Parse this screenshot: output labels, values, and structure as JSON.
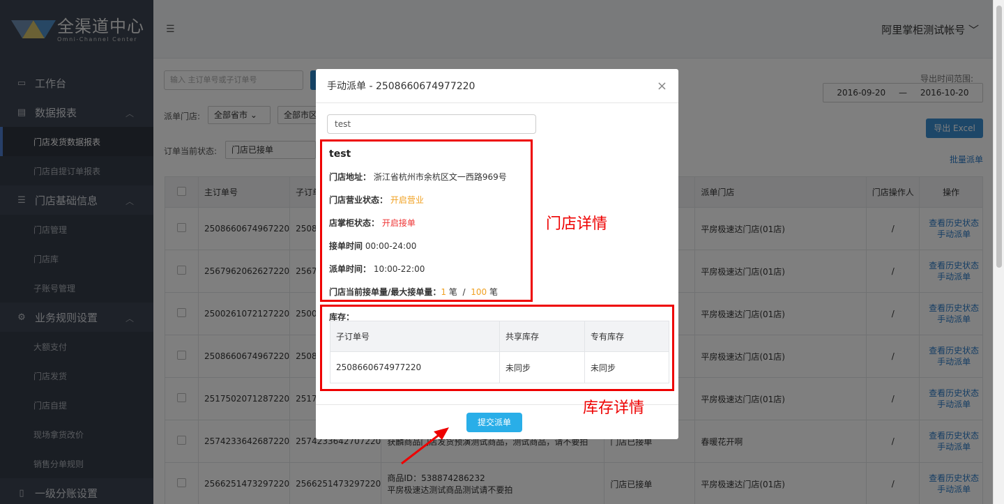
{
  "logo": {
    "title": "全渠道中心",
    "subtitle": "Omni-Channel Center"
  },
  "sidebar": {
    "groups": [
      {
        "label": "工作台",
        "icon": "monitor-icon"
      },
      {
        "label": "数据报表",
        "icon": "report-icon"
      },
      {
        "label": "门店基础信息",
        "icon": "list-icon"
      },
      {
        "label": "业务规则设置",
        "icon": "gear-icon"
      },
      {
        "label": "一级分账设置",
        "icon": "book-icon"
      }
    ],
    "report_items": [
      "门店发货数据报表",
      "门店自提订单报表"
    ],
    "store_items": [
      "门店管理",
      "门店库",
      "子账号管理"
    ],
    "rule_items": [
      "大额支付",
      "门店发货",
      "门店自提",
      "现场拿货改价",
      "销售分单规则"
    ]
  },
  "header": {
    "account": "阿里掌柜测试帐号",
    "menu_icon": "hamburger-icon"
  },
  "filters": {
    "search_placeholder": "输入 主订单号或子订单号",
    "export_range_label": "导出时间范围:",
    "date_from": "2016-09-20",
    "date_sep": "—",
    "date_to": "2016-10-20",
    "store_label": "派单门店:",
    "province": "全部省市",
    "district": "全部市区",
    "status_label": "订单当前状态:",
    "status": "门店已接单",
    "export_btn": "导出 Excel",
    "batch_link": "批量派单"
  },
  "table": {
    "headers": [
      "主订单号",
      "子订单号",
      "派单门店",
      "门店操作人",
      "操作"
    ],
    "op1": "查看历史状态",
    "op2": "手动派单",
    "rows": [
      {
        "main": "2508660674967220",
        "sub": "2508",
        "store": "平房极速达门店(01店)",
        "operator": "/"
      },
      {
        "main": "2567962062627220",
        "sub": "2567",
        "store": "平房极速达门店(01店)",
        "operator": "/"
      },
      {
        "main": "2500261072127220",
        "sub": "2500",
        "store": "平房极速达门店(01店)",
        "operator": "/"
      },
      {
        "main": "2508660674967220",
        "sub": "2508",
        "store": "平房极速达门店(01店)",
        "operator": "/"
      },
      {
        "main": "2517502071287220",
        "sub": "2517",
        "store": "平房极速达门店(01店)",
        "operator": "/"
      },
      {
        "main": "2574233642687220",
        "sub": "2574233642707220",
        "goods": "获麟商品门店发货预演测试商品，测试商品，请不要拍",
        "status": "门店已接单",
        "store": "春暖花开啊",
        "operator": "/"
      },
      {
        "main": "2566251473297220",
        "sub": "2566251473297220",
        "goods_id": "商品ID：538874286232",
        "goods": "平房极速达测试商品测试请不要拍",
        "status": "门店已接单",
        "store": "平房极速达门店(01店)",
        "operator": "/"
      }
    ]
  },
  "modal": {
    "title": "手动派单 - 2508660674977220",
    "close": "×",
    "input_value": "test",
    "store": {
      "name": "test",
      "address_label": "门店地址：",
      "address": "浙江省杭州市余杭区文一西路969号",
      "business_label": "门店营业状态：",
      "business_status": "开启营业",
      "counter_label": "店掌柜状态：",
      "counter_status": "开启接单",
      "accept_label": "接单时间",
      "accept_time": "00:00-24:00",
      "dispatch_label": "派单时间：",
      "dispatch_time": "10:00-22:00",
      "capacity_label": "门店当前接单量/最大接单量：",
      "current": "1",
      "unit1": "笔",
      "slash": "/",
      "max": "100",
      "unit2": "笔"
    },
    "stock": {
      "title": "库存：",
      "headers": [
        "子订单号",
        "共享库存",
        "专有库存"
      ],
      "row": [
        "2508660674977220",
        "未同步",
        "未同步"
      ]
    },
    "submit": "提交派单"
  },
  "annotations": {
    "store_detail": "门店详情",
    "stock_detail": "库存详情"
  }
}
